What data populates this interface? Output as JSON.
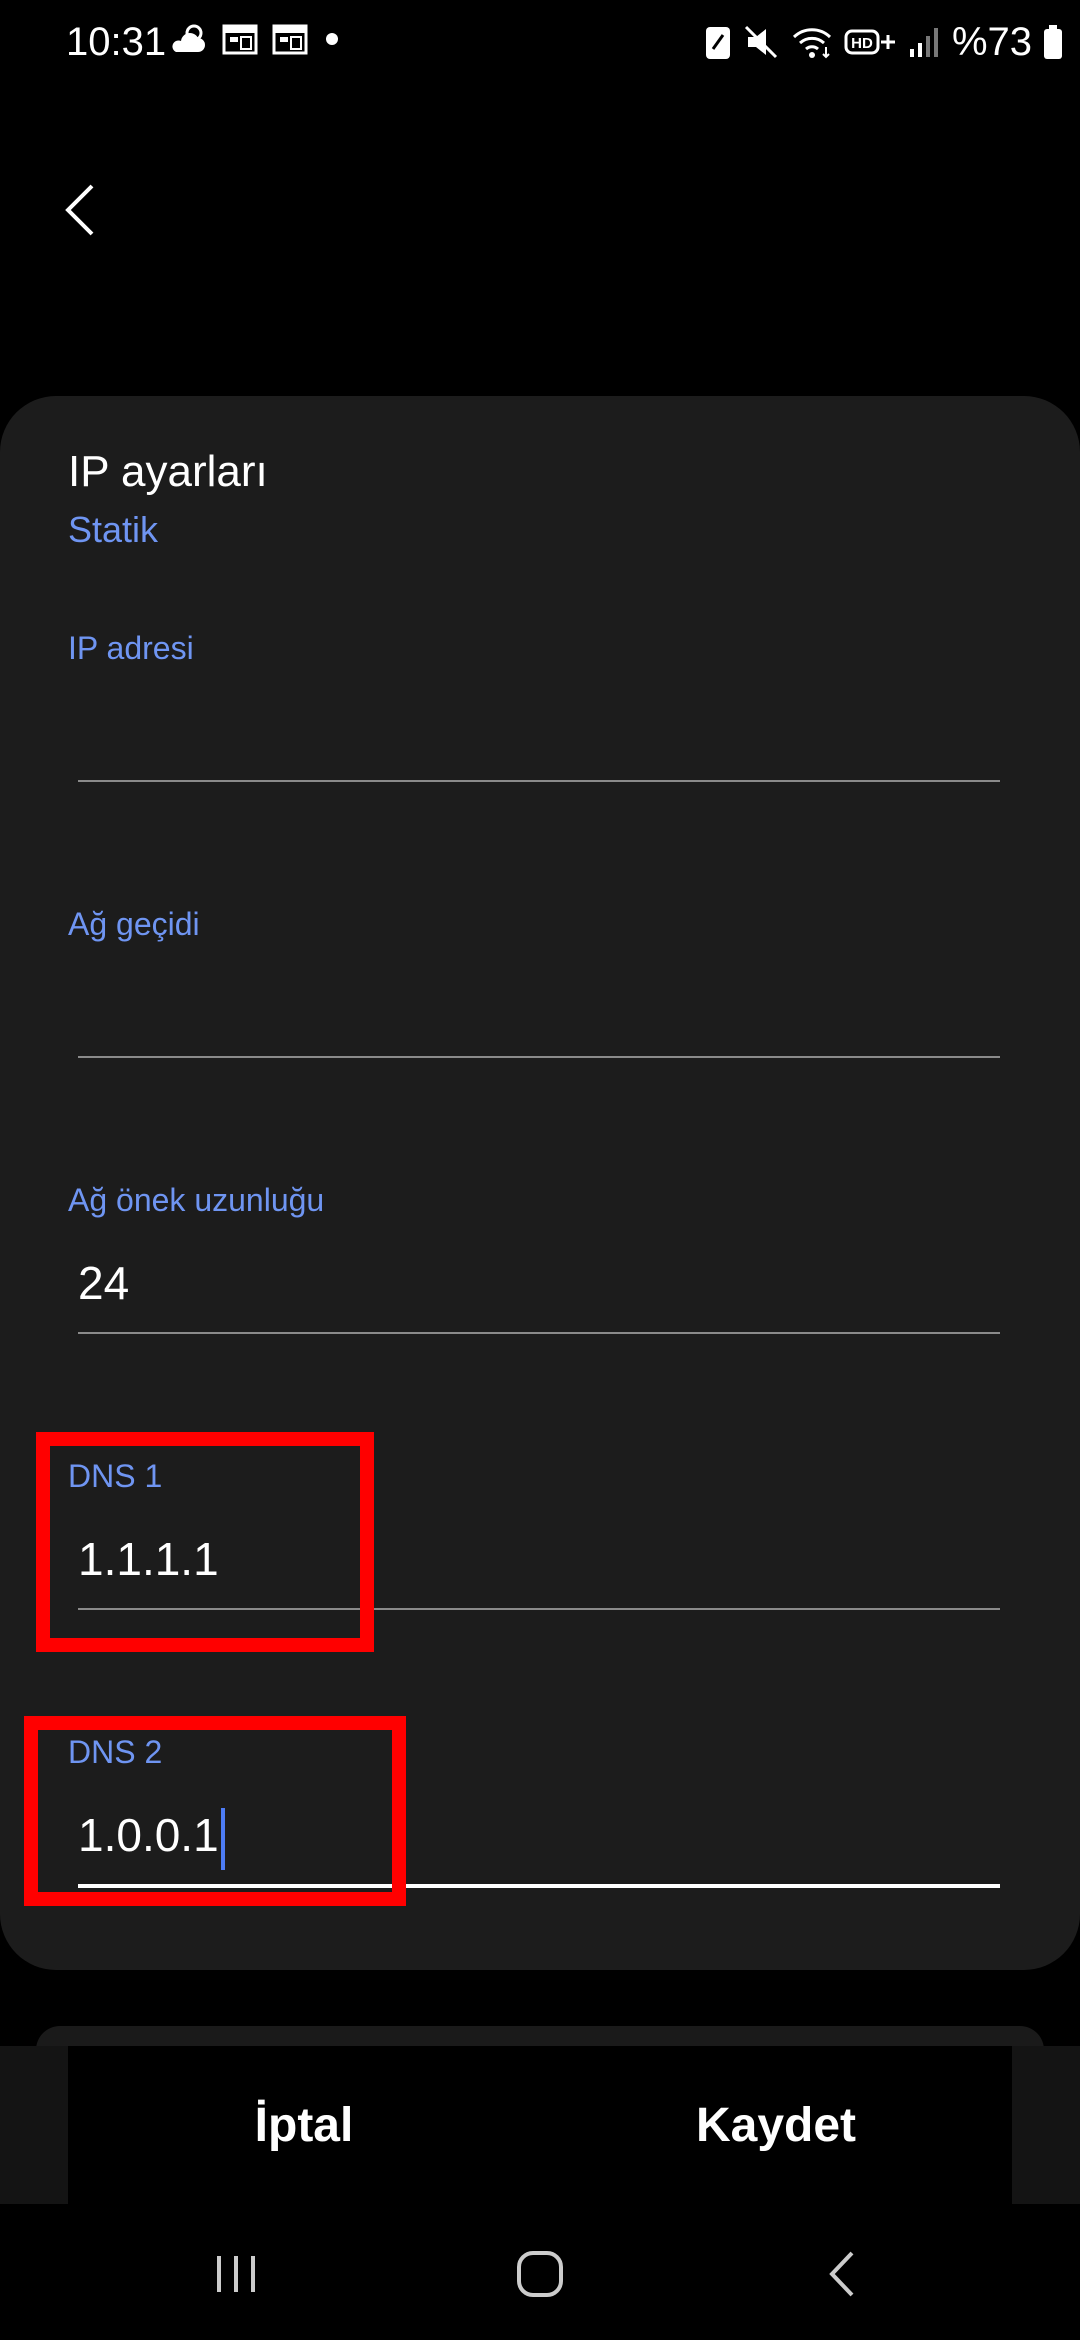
{
  "status_bar": {
    "time": "10:31",
    "battery_percent": "%73",
    "left_icons": [
      "weather-icon",
      "calendar-icon",
      "calendar-icon",
      "dot-icon"
    ],
    "right_icons": [
      "nfc-icon",
      "mute-icon",
      "wifi-icon",
      "hd-plus-icon",
      "signal-icon",
      "battery-icon"
    ]
  },
  "card": {
    "title": "IP ayarları",
    "subtitle": "Statik"
  },
  "fields": {
    "ip_address": {
      "label": "IP adresi",
      "value": ""
    },
    "gateway": {
      "label": "Ağ geçidi",
      "value": ""
    },
    "prefix_length": {
      "label": "Ağ önek uzunluğu",
      "value": "24"
    },
    "dns1": {
      "label": "DNS 1",
      "value": "1.1.1.1"
    },
    "dns2": {
      "label": "DNS 2",
      "value": "1.0.0.1"
    }
  },
  "actions": {
    "cancel_label": "İptal",
    "save_label": "Kaydet"
  },
  "colors": {
    "accent": "#6f95f2",
    "highlight": "#ff0000",
    "card_bg": "#1c1c1c",
    "caret": "#4d7cf5"
  }
}
